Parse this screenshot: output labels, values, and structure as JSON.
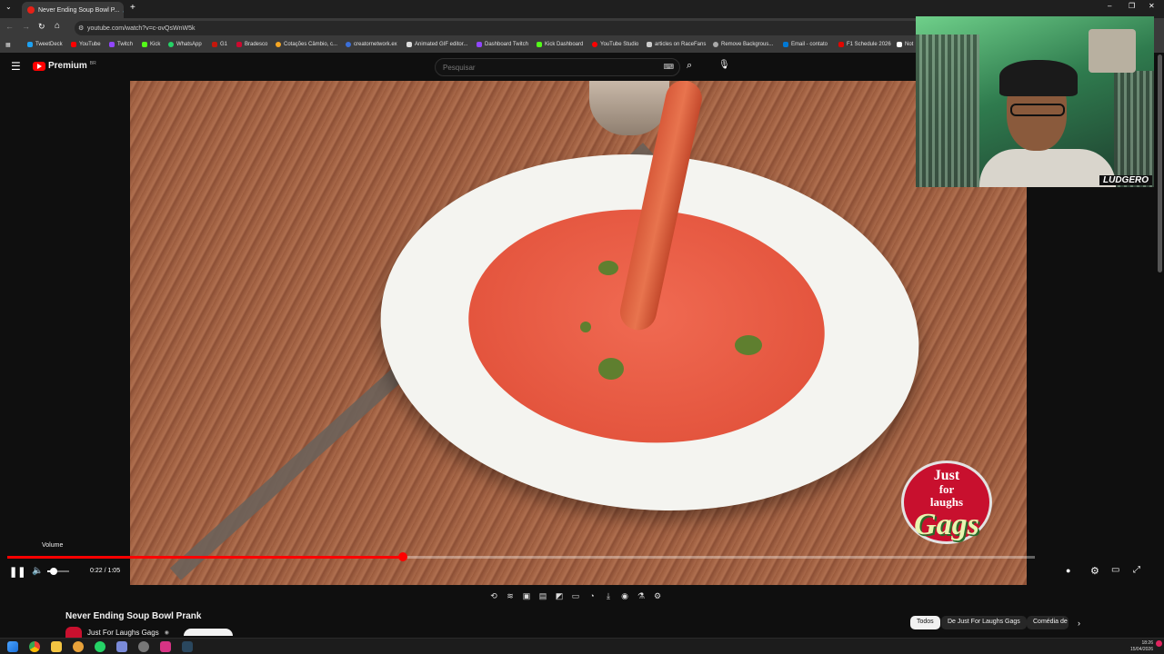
{
  "browser": {
    "tab_title": "Never Ending Soup Bowl P...",
    "url": "youtube.com/watch?v=c-ovQsWnW5k",
    "bookmarks": [
      "TweetDeck",
      "YouTube",
      "Twitch",
      "Kick",
      "WhatsApp",
      "G1",
      "Bradesco",
      "Cotações Câmbio, c...",
      "creatornetwork.ex",
      "Animated GIF editor...",
      "Dashboard Twitch",
      "Kick Dashboard",
      "YouTube Studio",
      "articles on RaceFans",
      "Remove Backgrous...",
      "Email - contato",
      "F1 Schedule 2026",
      "Not"
    ]
  },
  "youtube": {
    "logo_label": "Premium",
    "logo_badge": "BR",
    "search_placeholder": "Pesquisar"
  },
  "webcam": {
    "tag": "LUDGERO"
  },
  "video": {
    "logo_line1": "Just",
    "logo_line2": "for",
    "logo_line3": "laughs",
    "logo_line4": "Gags"
  },
  "player": {
    "tooltip": "Volume",
    "time": "0:22 / 1:05",
    "progress_fraction": 0.3846,
    "volume_fraction": 0.3
  },
  "meta": {
    "title": "Never Ending Soup Bowl Prank",
    "channel": "Just For Laughs Gags"
  },
  "chips": [
    "Todos",
    "De Just For Laughs Gags",
    "Comédia de"
  ],
  "taskbar": {
    "time": "18:26",
    "date": "15/04/2026"
  },
  "colors": {
    "progress": "#ff0000",
    "yt_red": "#ff0000",
    "background": "#0f0f0f"
  }
}
